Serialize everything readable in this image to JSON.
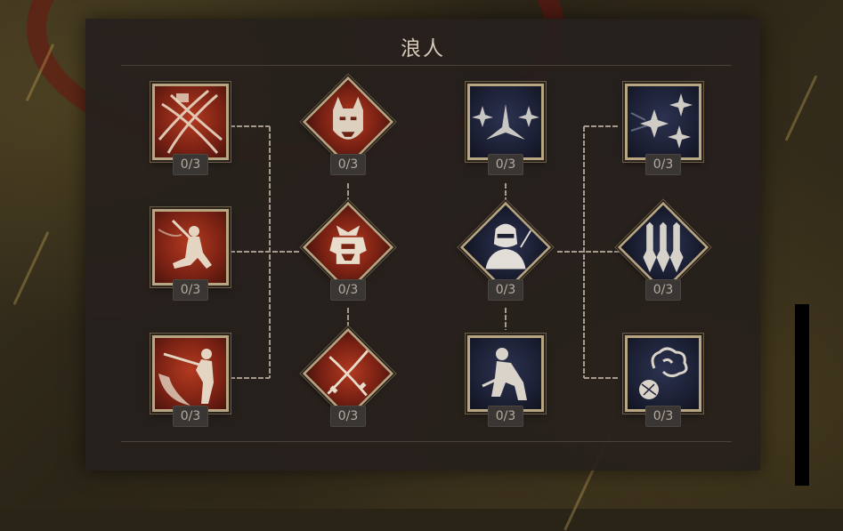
{
  "title": "浪人",
  "skills": [
    {
      "id": "slash-strike",
      "progress": "0/3"
    },
    {
      "id": "oni-mask",
      "progress": "0/3"
    },
    {
      "id": "triple-shuriken",
      "progress": "0/3"
    },
    {
      "id": "shuriken-barrage",
      "progress": "0/3"
    },
    {
      "id": "kneeling-swordsman",
      "progress": "0/3"
    },
    {
      "id": "samurai-helmet",
      "progress": "0/3"
    },
    {
      "id": "masked-ninja",
      "progress": "0/3"
    },
    {
      "id": "kunai-set",
      "progress": "0/3"
    },
    {
      "id": "heavy-cleave",
      "progress": "0/3"
    },
    {
      "id": "crossed-blades",
      "progress": "0/3"
    },
    {
      "id": "crouching-shinobi",
      "progress": "0/3"
    },
    {
      "id": "smoke-bomb",
      "progress": "0/3"
    }
  ],
  "colors": {
    "samurai_branch": "#9a2e18",
    "ninja_branch": "#1d2136",
    "frame_gold": "#b8a582",
    "connector": "#a59a8c"
  }
}
